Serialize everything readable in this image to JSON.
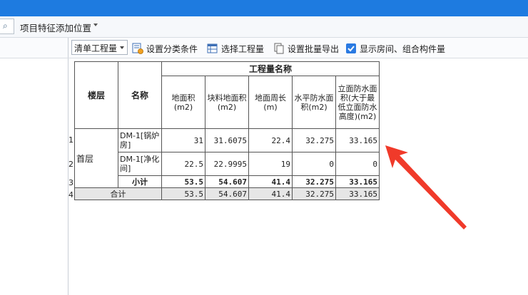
{
  "menubar": {
    "item": "项目特征添加位置"
  },
  "toolbar": {
    "combo_value": "清单工程量",
    "btn_classify": "设置分类条件",
    "btn_select": "选择工程量",
    "btn_export": "设置批量导出",
    "chk_show": "显示房间、组合构件量"
  },
  "table": {
    "h_floor": "楼层",
    "h_name": "名称",
    "h_group": "工程量名称",
    "col1": "地面积(m2)",
    "col2": "块料地面积(m2)",
    "col3": "地面周长(m)",
    "col4": "水平防水面积(m2)",
    "col5": "立面防水面积(大于最低立面防水高度)(m2)",
    "floor": "首层",
    "row_numbers": [
      "1",
      "2",
      "3",
      "4"
    ],
    "rows": [
      {
        "name": "DM-1[锅炉房]",
        "v1": "31",
        "v2": "31.6075",
        "v3": "22.4",
        "v4": "32.275",
        "v5": "33.165"
      },
      {
        "name": "DM-1[净化间]",
        "v1": "22.5",
        "v2": "22.9995",
        "v3": "19",
        "v4": "0",
        "v5": "0"
      }
    ],
    "subtotal": {
      "label": "小计",
      "v1": "53.5",
      "v2": "54.607",
      "v3": "41.4",
      "v4": "32.275",
      "v5": "33.165"
    },
    "total": {
      "label": "合计",
      "v1": "53.5",
      "v2": "54.607",
      "v3": "41.4",
      "v4": "32.275",
      "v5": "33.165"
    }
  },
  "colors": {
    "titlebar": "#1e7be0",
    "annotation_arrow": "#f03a2a"
  }
}
